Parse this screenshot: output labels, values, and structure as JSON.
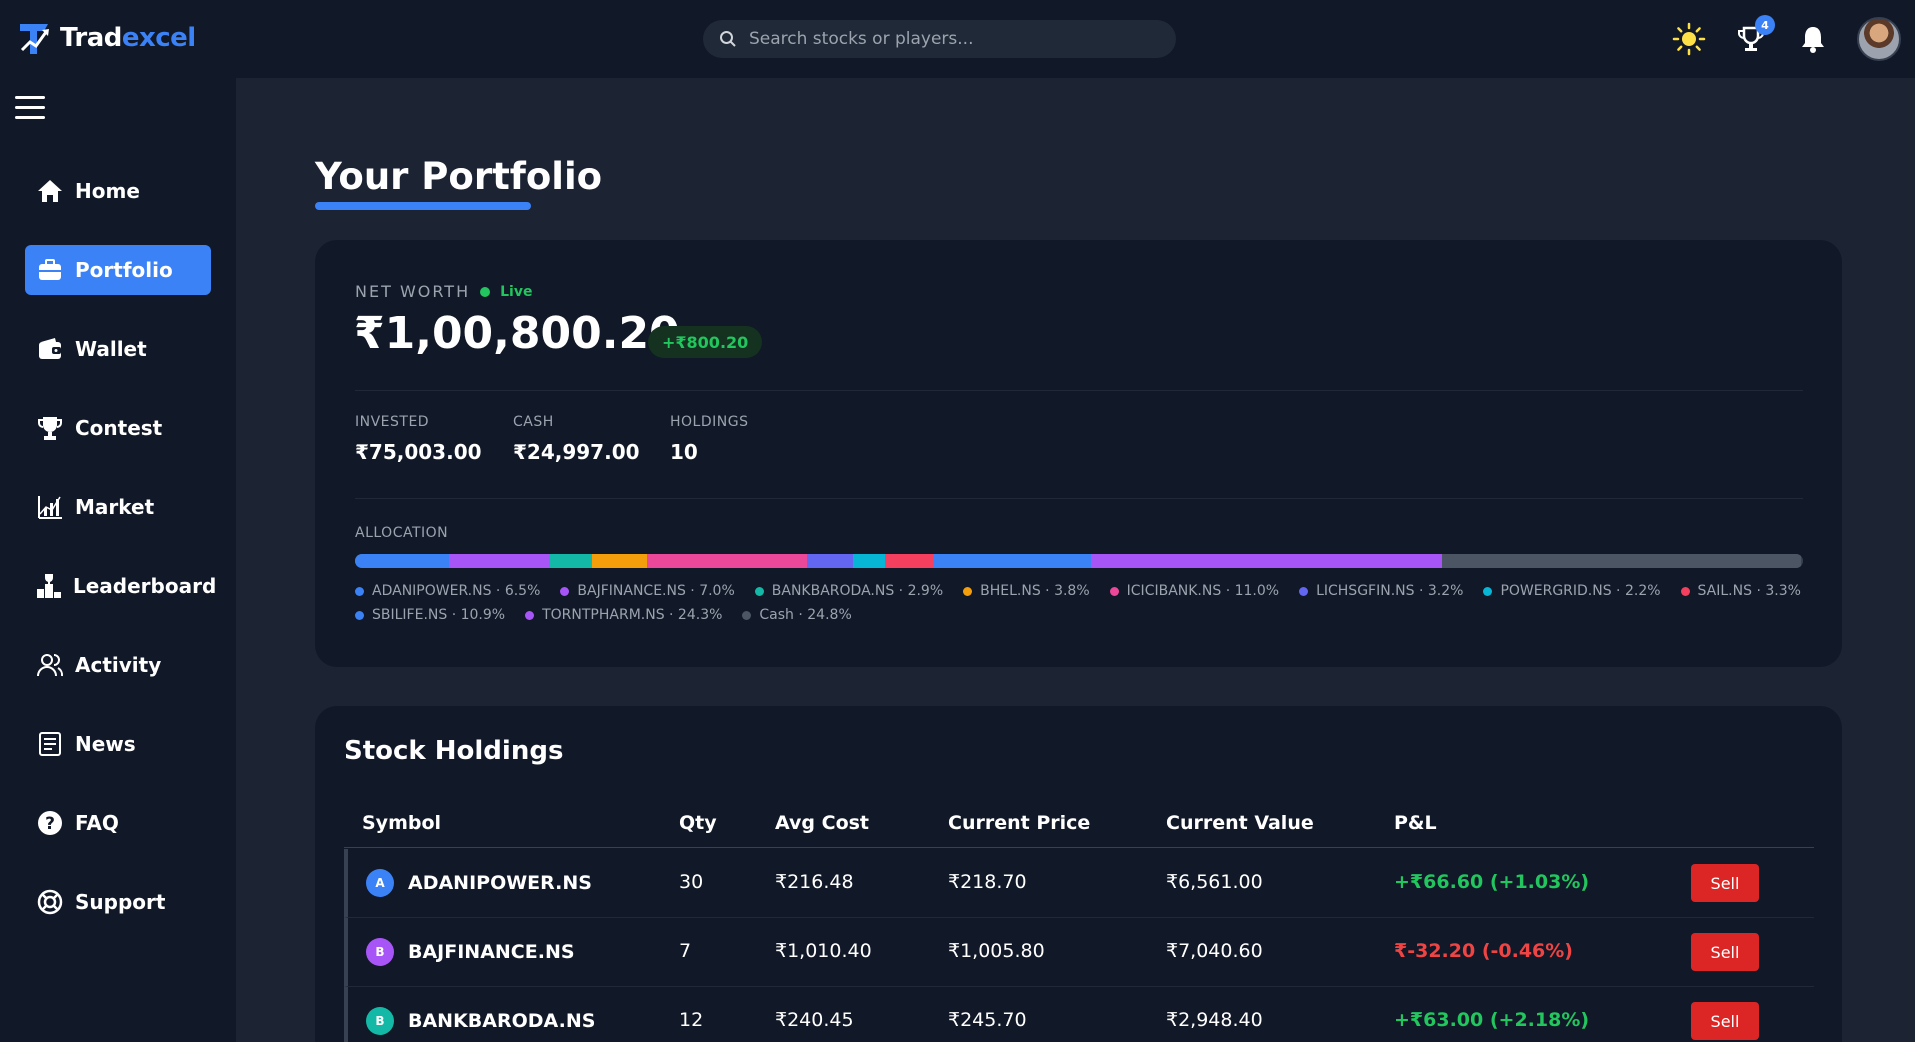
{
  "brand": {
    "name_part1": "Trad",
    "name_part2": "excel"
  },
  "search": {
    "placeholder": "Search stocks or players..."
  },
  "header": {
    "trophy_badge": "4"
  },
  "sidebar": {
    "items": [
      {
        "label": "Home",
        "icon": "home-icon"
      },
      {
        "label": "Portfolio",
        "icon": "briefcase-icon",
        "active": true
      },
      {
        "label": "Wallet",
        "icon": "wallet-icon"
      },
      {
        "label": "Contest",
        "icon": "trophy-icon"
      },
      {
        "label": "Market",
        "icon": "chart-icon"
      },
      {
        "label": "Leaderboard",
        "icon": "podium-icon"
      },
      {
        "label": "Activity",
        "icon": "users-icon"
      },
      {
        "label": "News",
        "icon": "newspaper-icon"
      },
      {
        "label": "FAQ",
        "icon": "question-icon"
      },
      {
        "label": "Support",
        "icon": "lifebuoy-icon"
      }
    ]
  },
  "page": {
    "title": "Your Portfolio"
  },
  "summary": {
    "net_worth_label": "NET WORTH",
    "live_label": "Live",
    "net_worth": "₹1,00,800.20",
    "change": "+₹800.20",
    "invested_label": "INVESTED",
    "invested": "₹75,003.00",
    "cash_label": "CASH",
    "cash": "₹24,997.00",
    "holdings_label": "HOLDINGS",
    "holdings": "10"
  },
  "allocation": {
    "label": "ALLOCATION",
    "items": [
      {
        "name": "ADANIPOWER.NS",
        "pct": 6.5,
        "text": "ADANIPOWER.NS · 6.5%",
        "color": "#3b82f6"
      },
      {
        "name": "BAJFINANCE.NS",
        "pct": 7.0,
        "text": "BAJFINANCE.NS · 7.0%",
        "color": "#a855f7"
      },
      {
        "name": "BANKBARODA.NS",
        "pct": 2.9,
        "text": "BANKBARODA.NS · 2.9%",
        "color": "#14b8a6"
      },
      {
        "name": "BHEL.NS",
        "pct": 3.8,
        "text": "BHEL.NS · 3.8%",
        "color": "#f59e0b"
      },
      {
        "name": "ICICIBANK.NS",
        "pct": 11.0,
        "text": "ICICIBANK.NS · 11.0%",
        "color": "#ec4899"
      },
      {
        "name": "LICHSGFIN.NS",
        "pct": 3.2,
        "text": "LICHSGFIN.NS · 3.2%",
        "color": "#6366f1"
      },
      {
        "name": "POWERGRID.NS",
        "pct": 2.2,
        "text": "POWERGRID.NS · 2.2%",
        "color": "#06b6d4"
      },
      {
        "name": "SAIL.NS",
        "pct": 3.3,
        "text": "SAIL.NS · 3.3%",
        "color": "#f43f5e"
      },
      {
        "name": "SBILIFE.NS",
        "pct": 10.9,
        "text": "SBILIFE.NS · 10.9%",
        "color": "#3b82f6"
      },
      {
        "name": "TORNTPHARM.NS",
        "pct": 24.3,
        "text": "TORNTPHARM.NS · 24.3%",
        "color": "#a855f7"
      },
      {
        "name": "Cash",
        "pct": 24.8,
        "text": "Cash · 24.8%",
        "color": "#4b5563"
      }
    ]
  },
  "holdings": {
    "title": "Stock Holdings",
    "columns": [
      "Symbol",
      "Qty",
      "Avg Cost",
      "Current Price",
      "Current Value",
      "P&L"
    ],
    "sell_label": "Sell",
    "rows": [
      {
        "initial": "A",
        "avatar_color": "#3b82f6",
        "symbol": "ADANIPOWER.NS",
        "qty": "30",
        "avg": "₹216.48",
        "price": "₹218.70",
        "value": "₹6,561.00",
        "pnl": "+₹66.60 (+1.03%)",
        "positive": true
      },
      {
        "initial": "B",
        "avatar_color": "#a855f7",
        "symbol": "BAJFINANCE.NS",
        "qty": "7",
        "avg": "₹1,010.40",
        "price": "₹1,005.80",
        "value": "₹7,040.60",
        "pnl": "₹-32.20 (-0.46%)",
        "positive": false
      },
      {
        "initial": "B",
        "avatar_color": "#14b8a6",
        "symbol": "BANKBARODA.NS",
        "qty": "12",
        "avg": "₹240.45",
        "price": "₹245.70",
        "value": "₹2,948.40",
        "pnl": "+₹63.00 (+2.18%)",
        "positive": true
      }
    ]
  }
}
